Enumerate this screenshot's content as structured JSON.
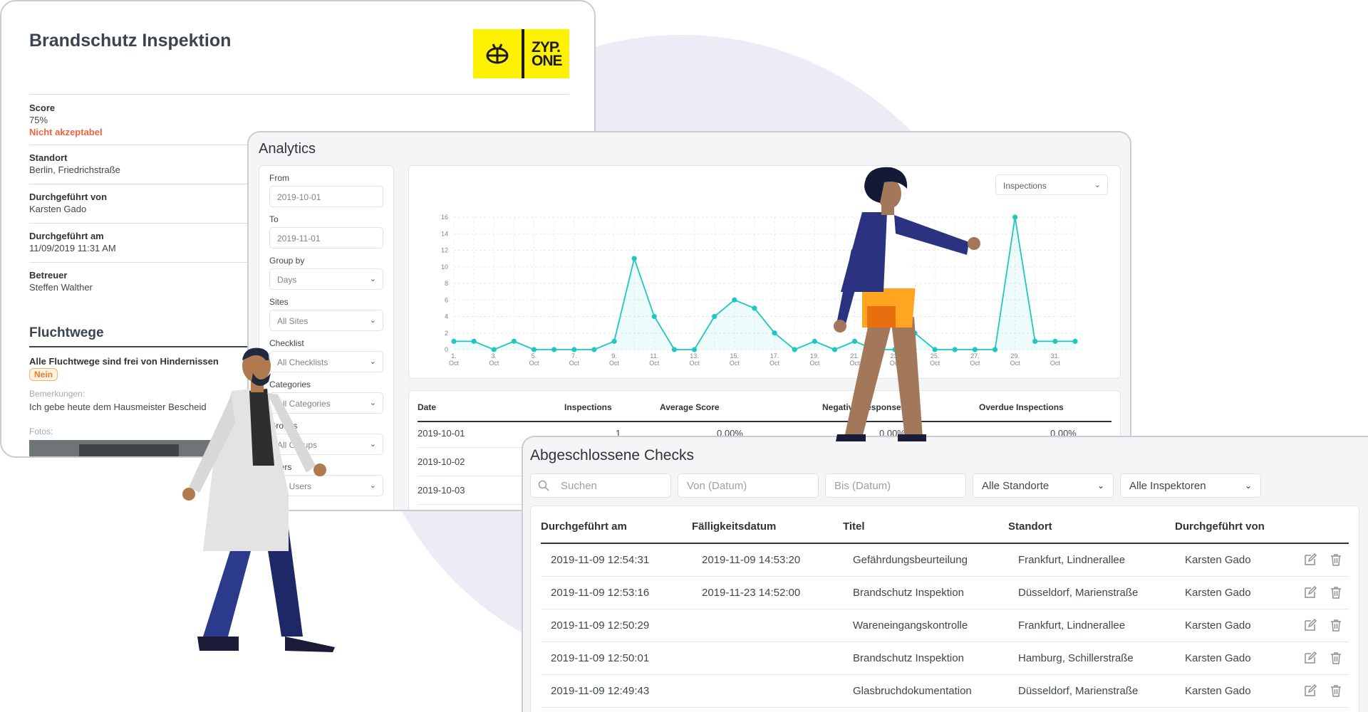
{
  "report": {
    "title": "Brandschutz Inspektion",
    "logo_text_1": "ZYP.",
    "logo_text_2": "ONE",
    "score_label": "Score",
    "score_value": "75%",
    "score_status": "Nicht akzeptabel",
    "location_label": "Standort",
    "location_value": "Berlin, Friedrichstraße",
    "performed_by_label": "Durchgeführt von",
    "performed_by_value": "Karsten Gado",
    "performed_at_label": "Durchgeführt am",
    "performed_at_value": "11/09/2019 11:31 AM",
    "supervisor_label": "Betreuer",
    "supervisor_value": "Steffen Walther",
    "section_title": "Fluchtwege",
    "question": "Alle Fluchtwege sind frei von Hindernissen",
    "answer": "Nein",
    "remarks_label": "Bemerkungen:",
    "remarks_value": "Ich gebe heute dem Hausmeister Bescheid",
    "photos_label": "Fotos:"
  },
  "analytics": {
    "title": "Analytics",
    "filters": [
      {
        "label": "From",
        "value": "2019-10-01",
        "dropdown": false
      },
      {
        "label": "To",
        "value": "2019-11-01",
        "dropdown": false
      },
      {
        "label": "Group by",
        "value": "Days",
        "dropdown": true
      },
      {
        "label": "Sites",
        "value": "All Sites",
        "dropdown": true
      },
      {
        "label": "Checklist",
        "value": "All Checklists",
        "dropdown": true
      },
      {
        "label": "Categories",
        "value": "All Categories",
        "dropdown": true
      },
      {
        "label": "Groups",
        "value": "All Groups",
        "dropdown": true
      },
      {
        "label": "Users",
        "value": "All Users",
        "dropdown": true
      }
    ],
    "metric_select": "Inspections",
    "table_headers": [
      "Date",
      "Inspections",
      "Average Score",
      "Negative Responses",
      "Overdue Inspections"
    ],
    "table_rows": [
      {
        "date": "2019-10-01",
        "inspections": "1",
        "avg": "0.00%",
        "neg": "0.00%",
        "overdue": "0.00%"
      },
      {
        "date": "2019-10-02"
      },
      {
        "date": "2019-10-03"
      }
    ]
  },
  "chart_data": {
    "type": "line",
    "x": [
      "1. Oct",
      "2. Oct",
      "3. Oct",
      "4. Oct",
      "5. Oct",
      "6. Oct",
      "7. Oct",
      "8. Oct",
      "9. Oct",
      "10. Oct",
      "11. Oct",
      "12. Oct",
      "13. Oct",
      "14. Oct",
      "15. Oct",
      "16. Oct",
      "17. Oct",
      "18. Oct",
      "19. Oct",
      "20. Oct",
      "21. Oct",
      "22. Oct",
      "23. Oct",
      "24. Oct",
      "25. Oct",
      "26. Oct",
      "27. Oct",
      "28. Oct",
      "29. Oct",
      "30. Oct",
      "31. Oct",
      "1. Nov"
    ],
    "x_tick_labels": [
      "1. Oct",
      "3. Oct",
      "5. Oct",
      "7. Oct",
      "9. Oct",
      "11. Oct",
      "13. Oct",
      "15. Oct",
      "17. Oct",
      "19. Oct",
      "21. Oct",
      "23. Oct",
      "25. Oct",
      "27. Oct",
      "29. Oct",
      "31. Oct"
    ],
    "series": [
      {
        "values": [
          1,
          1,
          0,
          1,
          0,
          0,
          0,
          0,
          1,
          11,
          4,
          0,
          0,
          4,
          6,
          5,
          2,
          0,
          1,
          0,
          1,
          0,
          0,
          2,
          0,
          0,
          0,
          0,
          16,
          1,
          1,
          1
        ]
      }
    ],
    "ylim": [
      0,
      16
    ],
    "yticks": [
      0,
      2,
      4,
      6,
      8,
      10,
      12,
      14,
      16
    ],
    "grid": true,
    "color": "#1ec8c0"
  },
  "checks": {
    "title": "Abgeschlossene Checks",
    "search_placeholder": "Suchen",
    "from_placeholder": "Von (Datum)",
    "to_placeholder": "Bis (Datum)",
    "sites_select": "Alle Standorte",
    "inspectors_select": "Alle Inspektoren",
    "headers": [
      "Durchgeführt am",
      "Fälligkeitsdatum",
      "Titel",
      "Standort",
      "Durchgeführt von"
    ],
    "rows": [
      {
        "done": "2019-11-09 12:54:31",
        "due": "2019-11-09 14:53:20",
        "title": "Gefährdungsbeurteilung",
        "site": "Frankfurt, Lindnerallee",
        "by": "Karsten Gado"
      },
      {
        "done": "2019-11-09 12:53:16",
        "due": "2019-11-23 14:52:00",
        "title": "Brandschutz Inspektion",
        "site": "Düsseldorf, Marienstraße",
        "by": "Karsten Gado"
      },
      {
        "done": "2019-11-09 12:50:29",
        "due": "",
        "title": "Wareneingangskontrolle",
        "site": "Frankfurt, Lindnerallee",
        "by": "Karsten Gado"
      },
      {
        "done": "2019-11-09 12:50:01",
        "due": "",
        "title": "Brandschutz Inspektion",
        "site": "Hamburg, Schillerstraße",
        "by": "Karsten Gado"
      },
      {
        "done": "2019-11-09 12:49:43",
        "due": "",
        "title": "Glasbruchdokumentation",
        "site": "Düsseldorf, Marienstraße",
        "by": "Karsten Gado"
      }
    ]
  }
}
